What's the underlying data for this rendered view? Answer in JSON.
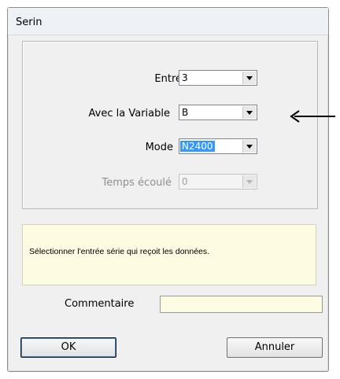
{
  "window": {
    "title": "Serin"
  },
  "form": {
    "entree": {
      "label": "Entrée",
      "value": "3"
    },
    "variable": {
      "label": "Avec la Variable",
      "value": "B"
    },
    "mode": {
      "label": "Mode",
      "value": "N2400"
    },
    "temps": {
      "label": "Temps écoulé",
      "value": "0"
    }
  },
  "info": {
    "text": "Sélectionner l'entrée série qui reçoit les données."
  },
  "comment": {
    "label": "Commentaire",
    "value": ""
  },
  "buttons": {
    "ok": "OK",
    "cancel": "Annuler"
  },
  "icons": {
    "dropdown": "chevron-down-icon",
    "pointer": "arrow-left-icon"
  },
  "colors": {
    "info_bg": "#fdfbe1",
    "selection": "#3399ff"
  }
}
